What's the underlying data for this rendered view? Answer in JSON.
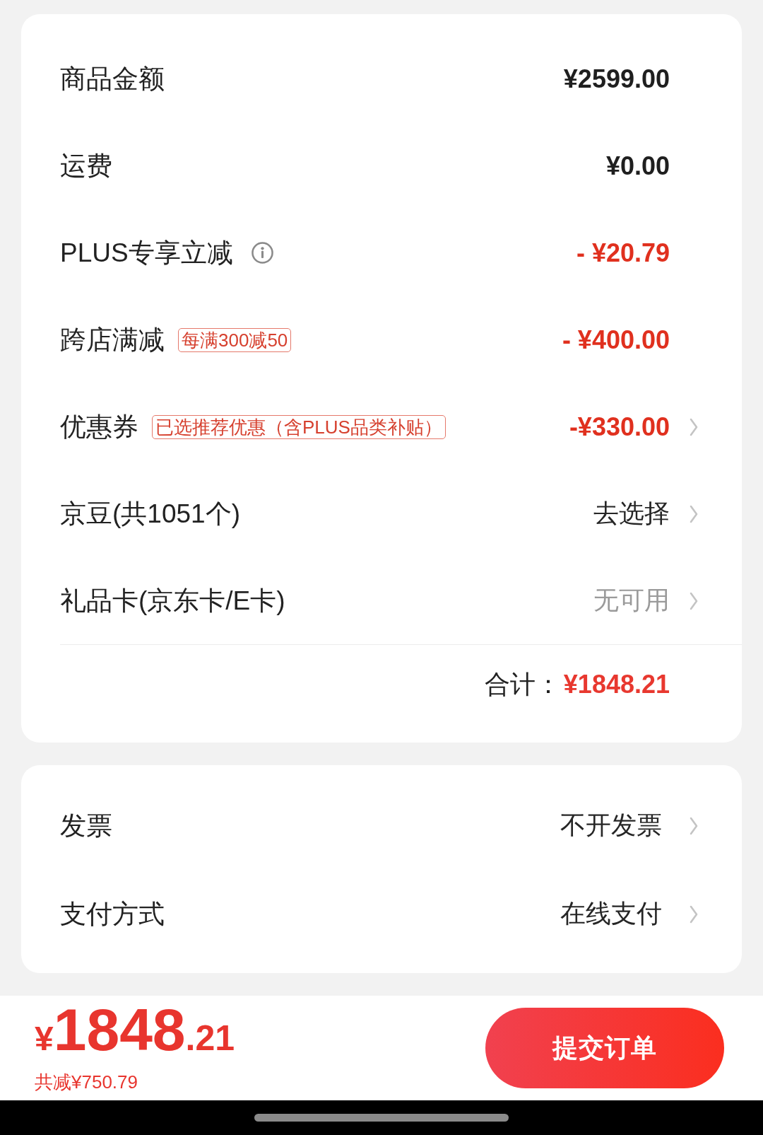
{
  "order_summary": {
    "rows": [
      {
        "label": "商品金额",
        "value": "¥2599.00",
        "kind": "amount",
        "disabled": false
      },
      {
        "label": "运费",
        "value": "¥0.00",
        "kind": "amount",
        "disabled": false
      },
      {
        "label": "PLUS专享立减",
        "info": true,
        "value": "- ¥20.79",
        "kind": "discount",
        "disabled": false
      },
      {
        "label": "跨店满减",
        "tag": "每满300减50",
        "value": "- ¥400.00",
        "kind": "discount",
        "disabled": false
      },
      {
        "label": "优惠券",
        "tag": "已选推荐优惠（含PLUS品类补贴）",
        "value": "-¥330.00",
        "kind": "discount",
        "chevron": true,
        "disabled": false
      },
      {
        "label": "京豆(共1051个)",
        "value": "去选择",
        "kind": "choice",
        "chevron": true,
        "disabled": false
      },
      {
        "label": "礼品卡(京东卡/E卡)",
        "value": "无可用",
        "kind": "choice",
        "chevron": true,
        "disabled": true
      }
    ],
    "total": {
      "label": "合计：",
      "value": "¥1848.21"
    }
  },
  "options": {
    "rows": [
      {
        "label": "发票",
        "value": "不开发票",
        "kind": "choice",
        "chevron": true,
        "disabled": false
      },
      {
        "label": "支付方式",
        "value": "在线支付",
        "kind": "choice",
        "chevron": true,
        "disabled": false
      }
    ]
  },
  "footer": {
    "price": {
      "currency": "¥",
      "integer": "1848",
      "decimal": ".21"
    },
    "savings": "共减¥750.79",
    "submit_button": "提交订单"
  }
}
